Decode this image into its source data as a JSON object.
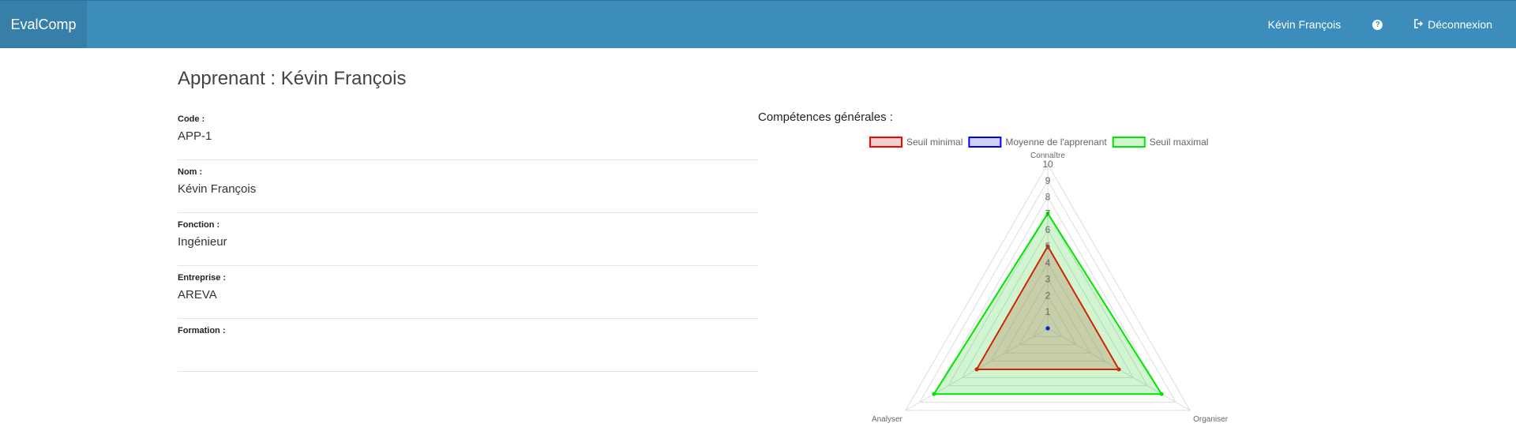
{
  "navbar": {
    "brand": "EvalComp",
    "user_name": "Kévin François",
    "help_icon": "question-circle-icon",
    "logout_icon": "sign-out-icon",
    "logout_label": "Déconnexion",
    "background": "#3c8dbc"
  },
  "page": {
    "title": "Apprenant : Kévin François",
    "fields": [
      {
        "label": "Code :",
        "value": "APP-1"
      },
      {
        "label": "Nom :",
        "value": "Kévin François"
      },
      {
        "label": "Fonction :",
        "value": "Ingénieur"
      },
      {
        "label": "Entreprise :",
        "value": "AREVA"
      },
      {
        "label": "Formation :",
        "value": ""
      }
    ]
  },
  "chart_title": "Compétences générales :",
  "chart_data": {
    "type": "radar",
    "categories": [
      "Connaître",
      "Organiser",
      "Analyser"
    ],
    "ticks": [
      "1",
      "2",
      "3",
      "4",
      "5",
      "6",
      "7",
      "8",
      "9",
      "10"
    ],
    "range": [
      0,
      10
    ],
    "legend_position": "top",
    "series": [
      {
        "name": "Seuil minimal",
        "values": [
          5,
          5,
          5
        ],
        "stroke": "#ff0000",
        "fill": "rgba(220,120,120,0.35)"
      },
      {
        "name": "Moyenne de l'apprenant",
        "values": [
          0,
          0,
          0
        ],
        "stroke": "#0000ff",
        "fill": "rgba(120,120,220,0.35)"
      },
      {
        "name": "Seuil maximal",
        "values": [
          7,
          8,
          8
        ],
        "stroke": "#00e600",
        "fill": "rgba(0,200,0,0.18)"
      }
    ]
  }
}
